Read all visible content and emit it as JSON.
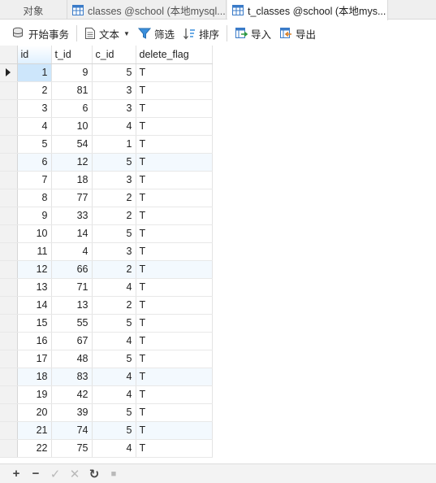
{
  "tabs": [
    {
      "label": "对象",
      "active": false,
      "icon": "none"
    },
    {
      "label": "classes @school (本地mysql...",
      "active": false,
      "icon": "table-icon"
    },
    {
      "label": "t_classes @school (本地mys...",
      "active": true,
      "icon": "table-icon"
    }
  ],
  "toolbar": {
    "begin_transaction": "开始事务",
    "text": "文本",
    "filter": "筛选",
    "sort": "排序",
    "import": "导入",
    "export": "导出"
  },
  "grid": {
    "columns": [
      "id",
      "t_id",
      "c_id",
      "delete_flag"
    ],
    "rows": [
      [
        "1",
        "9",
        "5",
        "T"
      ],
      [
        "2",
        "81",
        "3",
        "T"
      ],
      [
        "3",
        "6",
        "3",
        "T"
      ],
      [
        "4",
        "10",
        "4",
        "T"
      ],
      [
        "5",
        "54",
        "1",
        "T"
      ],
      [
        "6",
        "12",
        "5",
        "T"
      ],
      [
        "7",
        "18",
        "3",
        "T"
      ],
      [
        "8",
        "77",
        "2",
        "T"
      ],
      [
        "9",
        "33",
        "2",
        "T"
      ],
      [
        "10",
        "14",
        "5",
        "T"
      ],
      [
        "11",
        "4",
        "3",
        "T"
      ],
      [
        "12",
        "66",
        "2",
        "T"
      ],
      [
        "13",
        "71",
        "4",
        "T"
      ],
      [
        "14",
        "13",
        "2",
        "T"
      ],
      [
        "15",
        "55",
        "5",
        "T"
      ],
      [
        "16",
        "67",
        "4",
        "T"
      ],
      [
        "17",
        "48",
        "5",
        "T"
      ],
      [
        "18",
        "83",
        "4",
        "T"
      ],
      [
        "19",
        "42",
        "4",
        "T"
      ],
      [
        "20",
        "39",
        "5",
        "T"
      ],
      [
        "21",
        "74",
        "5",
        "T"
      ],
      [
        "22",
        "75",
        "4",
        "T"
      ]
    ],
    "selected_row": 0,
    "alt_rows": [
      5,
      11,
      17,
      20
    ]
  },
  "bottom_nav": {
    "add": "+",
    "delete": "−",
    "apply": "✓",
    "discard": "✕",
    "refresh": "↻",
    "stop": "■"
  },
  "colors": {
    "selection": "#cde6fb",
    "alt_row": "#f3f9fe",
    "accent_blue": "#2f7fd1"
  }
}
